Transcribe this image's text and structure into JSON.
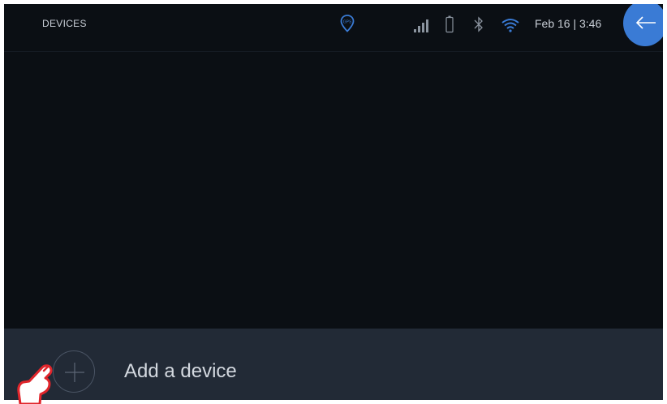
{
  "header": {
    "title": "DEVICES",
    "datetime": "Feb 16 | 3:46"
  },
  "status_icons": {
    "gps": "gps-icon",
    "signal": "signal-icon",
    "battery": "battery-icon",
    "bluetooth": "bluetooth-icon",
    "wifi": "wifi-icon"
  },
  "actions": {
    "back": "back-arrow-icon",
    "add_label": "Add a device"
  },
  "colors": {
    "background": "#0b0f14",
    "panel": "#222a36",
    "accent": "#3a7bd5",
    "text": "#c8ced6",
    "pointer_outline": "#e0252b"
  }
}
